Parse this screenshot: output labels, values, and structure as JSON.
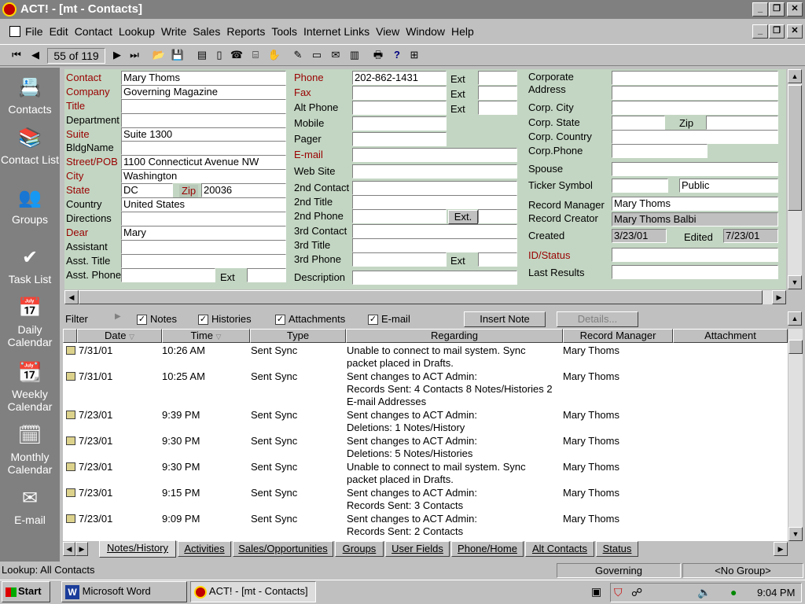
{
  "window": {
    "title": "ACT! - [mt - Contacts]"
  },
  "menu": [
    "File",
    "Edit",
    "Contact",
    "Lookup",
    "Write",
    "Sales",
    "Reports",
    "Tools",
    "Internet Links",
    "View",
    "Window",
    "Help"
  ],
  "toolbar": {
    "record_position": "55 of 119"
  },
  "sidebar": [
    {
      "label": "Contacts",
      "icon": "contacts-icon"
    },
    {
      "label": "Contact List",
      "icon": "contact-list-icon"
    },
    {
      "label": "Groups",
      "icon": "groups-icon"
    },
    {
      "label": "Task List",
      "icon": "task-list-icon"
    },
    {
      "label": "Daily Calendar",
      "icon": "daily-calendar-icon"
    },
    {
      "label": "Weekly Calendar",
      "icon": "weekly-calendar-icon"
    },
    {
      "label": "Monthly Calendar",
      "icon": "monthly-calendar-icon"
    },
    {
      "label": "E-mail",
      "icon": "email-icon"
    }
  ],
  "form": {
    "left": [
      {
        "label": "Contact",
        "value": "Mary Thoms",
        "red": true
      },
      {
        "label": "Company",
        "value": "Governing Magazine",
        "red": true
      },
      {
        "label": "Title",
        "value": "",
        "red": true
      },
      {
        "label": "Department",
        "value": "",
        "red": false
      },
      {
        "label": "Suite",
        "value": "Suite 1300",
        "red": true
      },
      {
        "label": "BldgName",
        "value": "",
        "red": false
      },
      {
        "label": "Street/POB",
        "value": "1100 Connecticut Avenue NW",
        "red": true
      },
      {
        "label": "City",
        "value": "Washington",
        "red": true
      },
      {
        "label": "State",
        "value": "DC",
        "red": true
      },
      {
        "label": "Country",
        "value": "United States",
        "red": false
      },
      {
        "label": "Directions",
        "value": "",
        "red": false
      },
      {
        "label": "Dear",
        "value": "Mary",
        "red": true
      },
      {
        "label": "Assistant",
        "value": "",
        "red": false
      },
      {
        "label": "Asst. Title",
        "value": "",
        "red": false
      },
      {
        "label": "Asst. Phone",
        "value": "",
        "red": false
      }
    ],
    "zip_label": "Zip",
    "zip_value": "20036",
    "ext_label": "Ext",
    "ext_dot_label": "Ext.",
    "middle": [
      {
        "label": "Phone",
        "value": "202-862-1431",
        "red": true
      },
      {
        "label": "Fax",
        "value": "",
        "red": true
      },
      {
        "label": "Alt Phone",
        "value": "",
        "red": false
      },
      {
        "label": "Mobile",
        "value": "",
        "red": false
      },
      {
        "label": "Pager",
        "value": "",
        "red": false
      },
      {
        "label": "E-mail",
        "value": "",
        "red": true
      },
      {
        "label": "Web Site",
        "value": "",
        "red": false
      },
      {
        "label": "2nd Contact",
        "value": "",
        "red": false
      },
      {
        "label": "2nd Title",
        "value": "",
        "red": false
      },
      {
        "label": "2nd Phone",
        "value": "",
        "red": false
      },
      {
        "label": "3rd Contact",
        "value": "",
        "red": false
      },
      {
        "label": "3rd Title",
        "value": "",
        "red": false
      },
      {
        "label": "3rd Phone",
        "value": "",
        "red": false
      },
      {
        "label": "Description",
        "value": "",
        "red": false
      }
    ],
    "right": {
      "corporate_address": "Corporate Address",
      "corp_city": "Corp. City",
      "corp_state": "Corp. State",
      "corp_country": "Corp. Country",
      "corp_phone": "Corp.Phone",
      "spouse": "Spouse",
      "ticker_symbol": "Ticker Symbol",
      "ticker_public": "Public",
      "record_manager_label": "Record Manager",
      "record_manager": "Mary Thoms",
      "record_creator_label": "Record Creator",
      "record_creator": "Mary Thoms Balbi",
      "created_label": "Created",
      "created": "3/23/01",
      "edited_label": "Edited",
      "edited": "7/23/01",
      "id_status": "ID/Status",
      "last_results": "Last Results"
    }
  },
  "filter": {
    "label": "Filter",
    "notes": "Notes",
    "histories": "Histories",
    "attachments": "Attachments",
    "email": "E-mail",
    "insert_note": "Insert Note",
    "details": "Details..."
  },
  "grid": {
    "columns": [
      "Date",
      "Time",
      "Type",
      "Regarding",
      "Record Manager",
      "Attachment"
    ],
    "rows": [
      {
        "date": "7/31/01",
        "time": "10:26 AM",
        "type": "Sent Sync",
        "regarding": [
          "Unable to connect to mail system. Sync",
          "packet placed in Drafts."
        ],
        "manager": "Mary Thoms"
      },
      {
        "date": "7/31/01",
        "time": "10:25 AM",
        "type": "Sent Sync",
        "regarding": [
          "Sent changes to ACT Admin:",
          "Records Sent: 4 Contacts 8 Notes/Histories 2",
          "E-mail Addresses"
        ],
        "manager": "Mary Thoms"
      },
      {
        "date": "7/23/01",
        "time": "9:39 PM",
        "type": "Sent Sync",
        "regarding": [
          "Sent changes to ACT Admin:",
          "Deletions: 1 Notes/History"
        ],
        "manager": "Mary Thoms"
      },
      {
        "date": "7/23/01",
        "time": "9:30 PM",
        "type": "Sent Sync",
        "regarding": [
          "Sent changes to ACT Admin:",
          "Deletions: 5 Notes/Histories"
        ],
        "manager": "Mary Thoms"
      },
      {
        "date": "7/23/01",
        "time": "9:30 PM",
        "type": "Sent Sync",
        "regarding": [
          "Unable to connect to mail system. Sync",
          "packet placed in Drafts."
        ],
        "manager": "Mary Thoms"
      },
      {
        "date": "7/23/01",
        "time": "9:15 PM",
        "type": "Sent Sync",
        "regarding": [
          "Sent changes to ACT Admin:",
          "Records Sent: 3 Contacts"
        ],
        "manager": "Mary Thoms"
      },
      {
        "date": "7/23/01",
        "time": "9:09 PM",
        "type": "Sent Sync",
        "regarding": [
          "Sent changes to ACT Admin:",
          "Records Sent: 2 Contacts"
        ],
        "manager": "Mary Thoms"
      }
    ]
  },
  "tabs": [
    "Notes/History",
    "Activities",
    "Sales/Opportunities",
    "Groups",
    "User Fields",
    "Phone/Home",
    "Alt Contacts",
    "Status"
  ],
  "statusbar": {
    "lookup": "Lookup: All Contacts",
    "group": "Governing",
    "no_group": "<No Group>"
  },
  "taskbar": {
    "start": "Start",
    "items": [
      "Microsoft Word",
      "ACT! - [mt - Contacts]"
    ],
    "clock": "9:04 PM"
  }
}
